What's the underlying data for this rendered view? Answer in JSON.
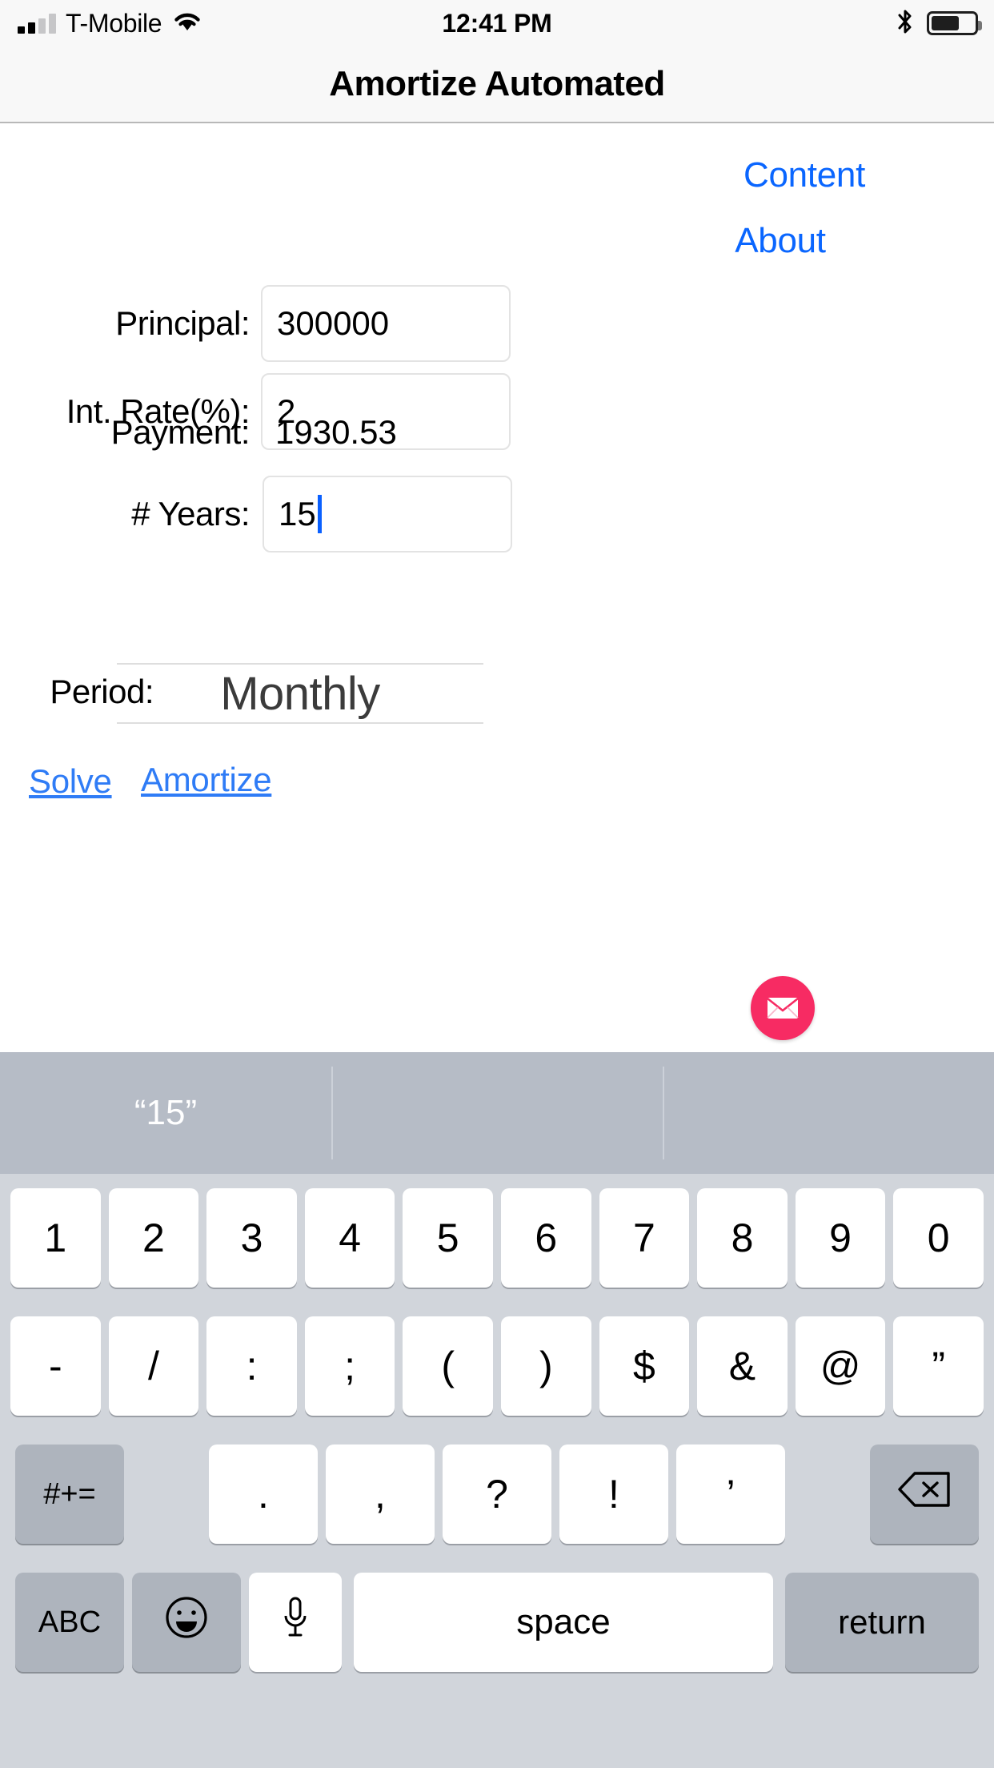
{
  "status_bar": {
    "carrier": "T-Mobile",
    "time": "12:41 PM",
    "signal_bars_filled": 2,
    "signal_bars_total": 4,
    "wifi": "wifi-icon",
    "bluetooth": "bluetooth-icon",
    "battery_percent": 62
  },
  "nav": {
    "title": "Amortize Automated"
  },
  "links": {
    "content": "Content",
    "about": "About"
  },
  "form": {
    "principal": {
      "label": "Principal:",
      "value": "300000"
    },
    "rate": {
      "label": "Int. Rate(%):",
      "value": "2"
    },
    "payment": {
      "label": "Payment:",
      "value": "1930.53"
    },
    "years": {
      "label": "# Years:",
      "value": "15"
    },
    "period": {
      "label": "Period:",
      "value": "Monthly"
    }
  },
  "actions": {
    "solve": "Solve",
    "amortize": "Amortize",
    "mail": "mail-icon"
  },
  "keyboard": {
    "suggestions": [
      "“15”",
      "",
      ""
    ],
    "row1": [
      "1",
      "2",
      "3",
      "4",
      "5",
      "6",
      "7",
      "8",
      "9",
      "0"
    ],
    "row2": [
      "-",
      "/",
      ":",
      ";",
      "(",
      ")",
      "$",
      "&",
      "@",
      "”"
    ],
    "row3": {
      "symbols_key": "#+=",
      "keys": [
        ".",
        ",",
        "?",
        "!",
        "’"
      ],
      "backspace": "backspace-icon"
    },
    "row4": {
      "abc": "ABC",
      "emoji": "emoji-icon",
      "mic": "microphone-icon",
      "space": "space",
      "return": "return"
    }
  },
  "colors": {
    "link_blue": "#0a66ff",
    "button_blue": "#2f7cf6",
    "mail_pink": "#f72b63",
    "keyboard_bg": "#d1d5db",
    "suggestion_bg": "#b6bcc6"
  }
}
